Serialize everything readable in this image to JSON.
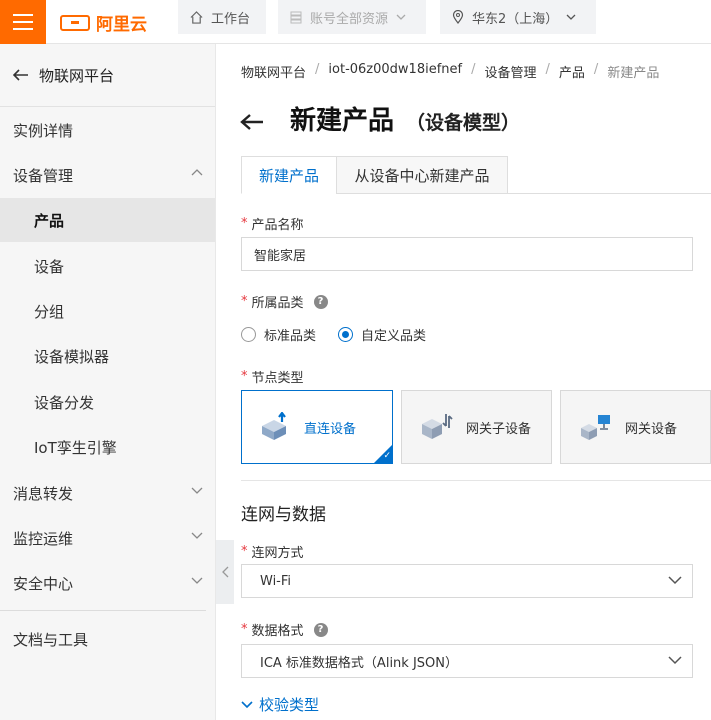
{
  "topbar": {
    "logo_text": "阿里云",
    "workspace": "工作台",
    "account_resources": "账号全部资源",
    "region": "华东2（上海）"
  },
  "sidebar": {
    "back_label": "物联网平台",
    "items": [
      {
        "label": "实例详情"
      },
      {
        "label": "设备管理"
      },
      {
        "label": "产品"
      },
      {
        "label": "设备"
      },
      {
        "label": "分组"
      },
      {
        "label": "设备模拟器"
      },
      {
        "label": "设备分发"
      },
      {
        "label": "IoT孪生引擎"
      },
      {
        "label": "消息转发"
      },
      {
        "label": "监控运维"
      },
      {
        "label": "安全中心"
      },
      {
        "label": "文档与工具"
      }
    ]
  },
  "breadcrumb": [
    "物联网平台",
    "iot-06z00dw18iefnef",
    "设备管理",
    "产品",
    "新建产品"
  ],
  "page": {
    "title": "新建产品",
    "subtitle": "（设备模型）"
  },
  "tabs": [
    "新建产品",
    "从设备中心新建产品"
  ],
  "form": {
    "required_mark": "*",
    "product_name_label": "产品名称",
    "product_name_value": "智能家居",
    "category_label": "所属品类",
    "category_options": [
      "标准品类",
      "自定义品类"
    ],
    "category_selected": "自定义品类",
    "node_type_label": "节点类型",
    "node_types": [
      "直连设备",
      "网关子设备",
      "网关设备"
    ],
    "node_selected": "直连设备",
    "section_network": "连网与数据",
    "network_label": "连网方式",
    "network_value": "Wi-Fi",
    "data_format_label": "数据格式",
    "data_format_value": "ICA 标准数据格式（Alink JSON）",
    "verify_label": "校验类型"
  },
  "colors": {
    "brand": "#ff6a00",
    "accent": "#0070cc",
    "required": "#e5363d"
  }
}
